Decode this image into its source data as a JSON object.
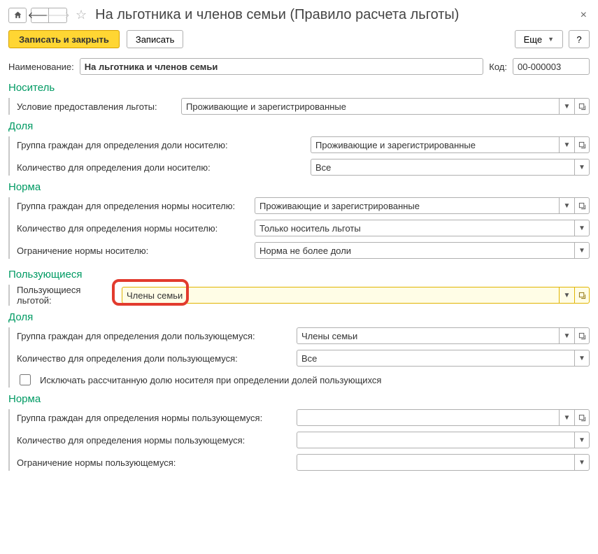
{
  "title": "На льготника и членов семьи (Правило расчета льготы)",
  "toolbar": {
    "save_close": "Записать и закрыть",
    "save": "Записать",
    "more": "Еще",
    "help": "?"
  },
  "header": {
    "name_label": "Наименование:",
    "name_value": "На льготника и членов семьи",
    "code_label": "Код:",
    "code_value": "00-000003"
  },
  "carrier": {
    "section": "Носитель",
    "cond_label": "Условие предоставления льготы:",
    "cond_value": "Проживающие и зарегистрированные",
    "share_section": "Доля",
    "share_group_label": "Группа граждан для определения доли носителю:",
    "share_group_value": "Проживающие и зарегистрированные",
    "share_qty_label": "Количество для определения доли носителю:",
    "share_qty_value": "Все",
    "norm_section": "Норма",
    "norm_group_label": "Группа граждан для определения нормы носителю:",
    "norm_group_value": "Проживающие и зарегистрированные",
    "norm_qty_label": "Количество для определения нормы носителю:",
    "norm_qty_value": "Только носитель льготы",
    "norm_limit_label": "Ограничение нормы носителю:",
    "norm_limit_value": "Норма не более доли"
  },
  "users": {
    "section": "Пользующиеся",
    "who_label": "Пользующиеся льготой:",
    "who_value": "Члены семьи",
    "share_section": "Доля",
    "share_group_label": "Группа граждан для определения доли пользующемуся:",
    "share_group_value": "Члены семьи",
    "share_qty_label": "Количество для определения доли пользующемуся:",
    "share_qty_value": "Все",
    "exclude_label": "Исключать рассчитанную долю носителя при определении долей пользующихся",
    "norm_section": "Норма",
    "norm_group_label": "Группа граждан для определения нормы пользующемуся:",
    "norm_group_value": "",
    "norm_qty_label": "Количество для определения нормы пользующемуся:",
    "norm_qty_value": "",
    "norm_limit_label": "Ограничение нормы пользующемуся:",
    "norm_limit_value": ""
  }
}
